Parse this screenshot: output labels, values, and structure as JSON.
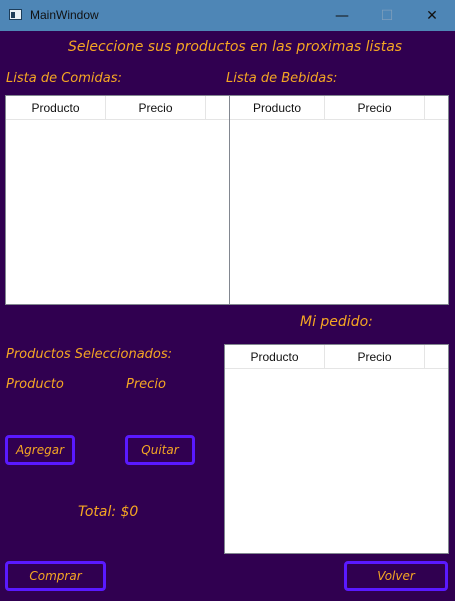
{
  "window": {
    "title": "MainWindow",
    "minimize_glyph": "—",
    "maximize_glyph": "☐",
    "close_glyph": "✕"
  },
  "header": {
    "prompt": "Seleccione sus productos en las proximas listas"
  },
  "lists": {
    "comidas": {
      "label": "Lista de Comidas:",
      "columns": [
        "Producto",
        "Precio"
      ],
      "rows": []
    },
    "bebidas": {
      "label": "Lista de Bebidas:",
      "columns": [
        "Producto",
        "Precio"
      ],
      "rows": []
    },
    "pedido": {
      "label": "Mi pedido:",
      "columns": [
        "Producto",
        "Precio"
      ],
      "rows": []
    }
  },
  "selected": {
    "label": "Productos Seleccionados:",
    "producto_label": "Producto",
    "precio_label": "Precio"
  },
  "buttons": {
    "agregar": "Agregar",
    "quitar": "Quitar",
    "comprar": "Comprar",
    "volver": "Volver"
  },
  "total": {
    "text": "Total: $0"
  },
  "colors": {
    "background": "#300050",
    "accent_text": "#f5a623",
    "button_border": "#5a19ff",
    "titlebar": "#4e86b6"
  }
}
